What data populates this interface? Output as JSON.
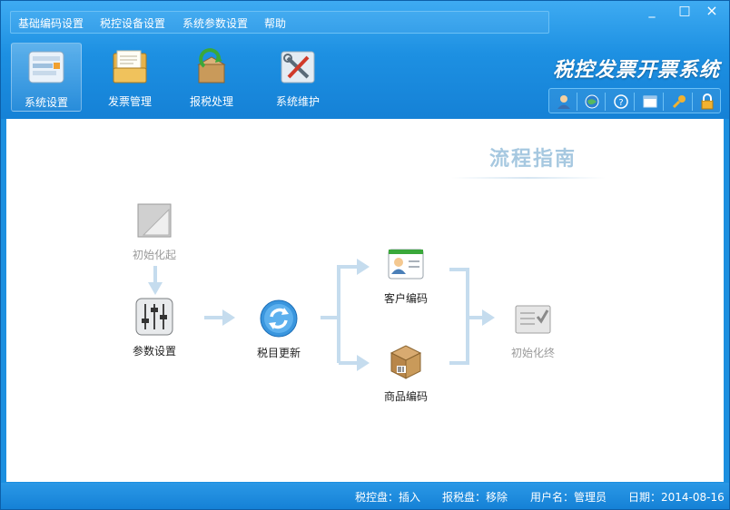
{
  "menu": [
    "基础编码设置",
    "税控设备设置",
    "系统参数设置",
    "帮助"
  ],
  "window_controls": {
    "minimize": "_",
    "maximize": "□",
    "close": "×"
  },
  "nav": [
    {
      "label": "系统设置",
      "icon": "settings-panel-icon",
      "active": true
    },
    {
      "label": "发票管理",
      "icon": "invoice-folder-icon",
      "active": false
    },
    {
      "label": "报税处理",
      "icon": "tax-report-box-icon",
      "active": false
    },
    {
      "label": "系统维护",
      "icon": "maintenance-tools-icon",
      "active": false
    }
  ],
  "app_title": "税控发票开票系统",
  "toolbar_icons": [
    "user-icon",
    "globe-icon",
    "help-icon",
    "window-icon",
    "key-icon",
    "lock-icon"
  ],
  "guide": {
    "title": "流程指南",
    "steps": {
      "init_start": "初始化起",
      "params": "参数设置",
      "tax_update": "税目更新",
      "customer_code": "客户编码",
      "product_code": "商品编码",
      "init_end": "初始化终"
    }
  },
  "status": {
    "tax_disk": "税控盘：插入",
    "report_disk": "报税盘：移除",
    "username": "用户名：管理员",
    "date": "日期：2014-08-16"
  },
  "colors": {
    "brand_blue": "#1d90e2",
    "arrow_blue": "#c5dcee",
    "guide_title": "#a6c8e0"
  }
}
